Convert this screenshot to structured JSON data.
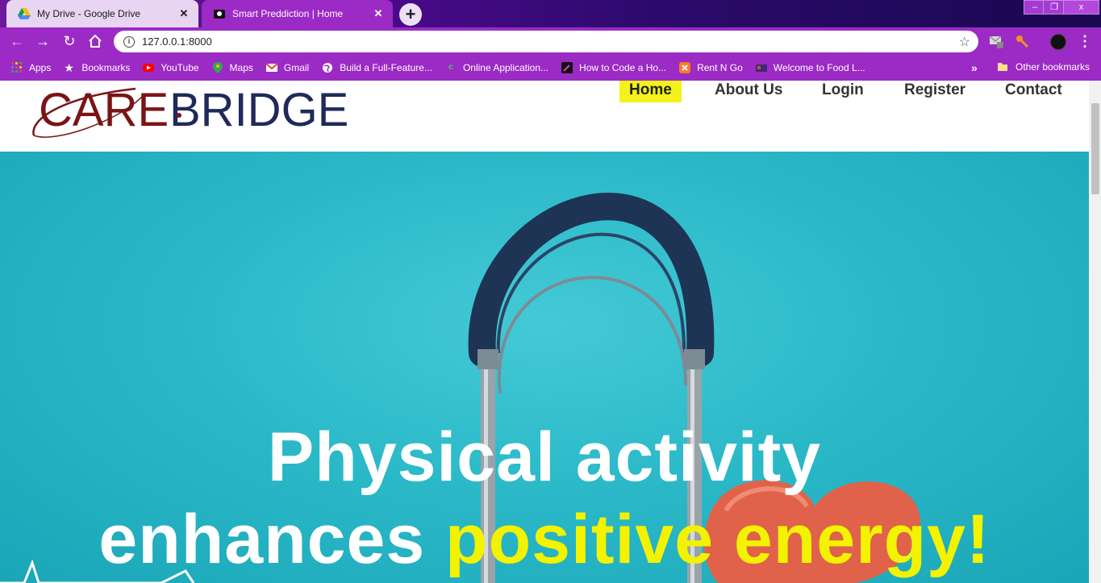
{
  "browser": {
    "tabs": [
      {
        "title": "My Drive - Google Drive",
        "active": false
      },
      {
        "title": "Smart Preddiction | Home",
        "active": true
      }
    ],
    "new_tab_label": "+",
    "close_label": "✕",
    "window_controls": {
      "minimize": "–",
      "restore": "❐",
      "close": "x"
    },
    "address": "127.0.0.1:8000",
    "bookmarks": [
      {
        "label": "Apps",
        "icon": "apps-grid-icon"
      },
      {
        "label": "Bookmarks",
        "icon": "star-icon"
      },
      {
        "label": "YouTube",
        "icon": "youtube-icon"
      },
      {
        "label": "Maps",
        "icon": "maps-icon"
      },
      {
        "label": "Gmail",
        "icon": "gmail-icon"
      },
      {
        "label": "Build a Full-Feature...",
        "icon": "globe-icon"
      },
      {
        "label": "Online Application...",
        "icon": "c-icon"
      },
      {
        "label": "How to Code a Ho...",
        "icon": "pen-icon"
      },
      {
        "label": "Rent N Go",
        "icon": "xampp-icon"
      },
      {
        "label": "Welcome to Food L...",
        "icon": "food-icon"
      }
    ],
    "bookmarks_more": "»",
    "other_bookmarks": "Other bookmarks"
  },
  "site": {
    "logo_text_care": "CARE",
    "logo_text_bridge": "BRIDGE",
    "nav": [
      {
        "label": "Home",
        "active": true
      },
      {
        "label": "About Us",
        "active": false
      },
      {
        "label": "Login",
        "active": false
      },
      {
        "label": "Register",
        "active": false
      },
      {
        "label": "Contact",
        "active": false
      }
    ],
    "hero": {
      "line1": "Physical activity",
      "line2_white": "enhances ",
      "line2_yellow": "positive energy!"
    }
  },
  "colors": {
    "browser_frame": "#9b2bc4",
    "active_nav_bg": "#f4f21a",
    "hero_bg": "#2bb9c8",
    "headline_yellow": "#f3f300",
    "logo_red": "#7a1416",
    "logo_navy": "#1f2a5a"
  }
}
